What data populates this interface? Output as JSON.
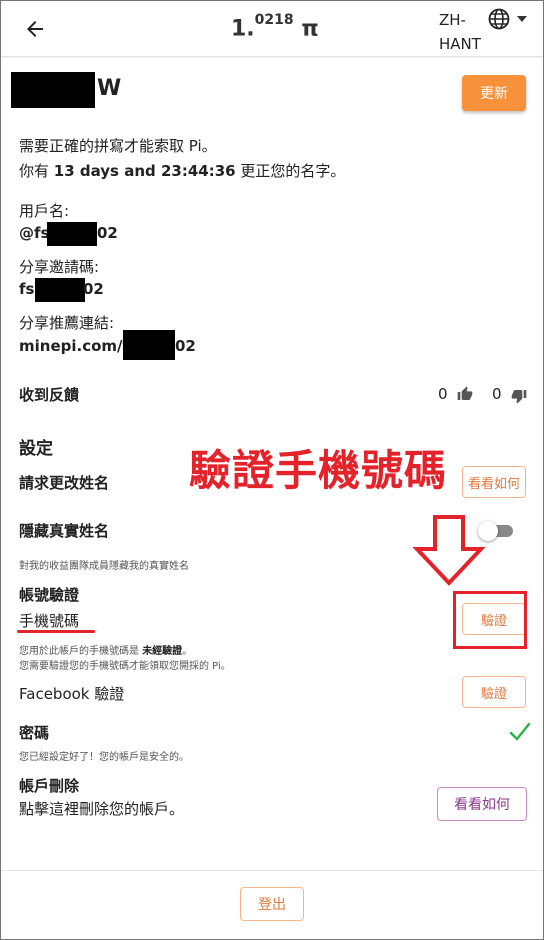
{
  "header": {
    "balance_int": "1.",
    "balance_sup": "0218",
    "pi_symbol": "π",
    "language": "ZH-HANT"
  },
  "profile": {
    "name_suffix": "W",
    "update_button": "更新",
    "spelling_note": "需要正確的拼寫才能索取 Pi。",
    "time_prefix": "你有 ",
    "time_value": "13 days and 23:44:36",
    "time_suffix": " 更正您的名字。",
    "username_label": "用戶名:",
    "username_prefix": "@fs",
    "username_suffix": "02",
    "invite_label": "分享邀請碼:",
    "invite_prefix": "fs",
    "invite_suffix": "02",
    "referral_label": "分享推薦連結:",
    "referral_prefix": "minepi.com/fs",
    "referral_suffix": "02"
  },
  "feedback": {
    "label": "收到反饋",
    "likes": "0",
    "dislikes": "0"
  },
  "settings": {
    "title": "設定",
    "change_name_label": "請求更改姓名",
    "change_name_button": "看看如何",
    "hide_name_label": "隱藏真實姓名",
    "hide_name_desc": "對我的收益團隊成員隱藏我的真實姓名",
    "hide_name_on": false,
    "account_verify_title": "帳號驗證",
    "phone_label": "手機號碼",
    "phone_desc_1_pre": "您用於此帳戶的手機號碼是 ",
    "phone_desc_1_status": "未經驗證",
    "phone_desc_1_post": "。",
    "phone_desc_2": "您需要驗證您的手機號碼才能領取您開採的 Pi。",
    "phone_button": "驗證",
    "facebook_label": "Facebook 驗證",
    "facebook_button": "驗證",
    "password_label": "密碼",
    "password_desc": "您已經設定好了！您的帳戶是安全的。",
    "delete_title": "帳戶刪除",
    "delete_desc": "點擊這裡刪除您的帳戶。",
    "delete_button": "看看如何"
  },
  "annotation": {
    "text": "驗證手機號碼",
    "color": "#e3222a"
  },
  "footer": {
    "logout_button": "登出"
  },
  "colors": {
    "accent": "#f7913c",
    "check": "#2bb34a",
    "purple": "#8c3a8c"
  }
}
